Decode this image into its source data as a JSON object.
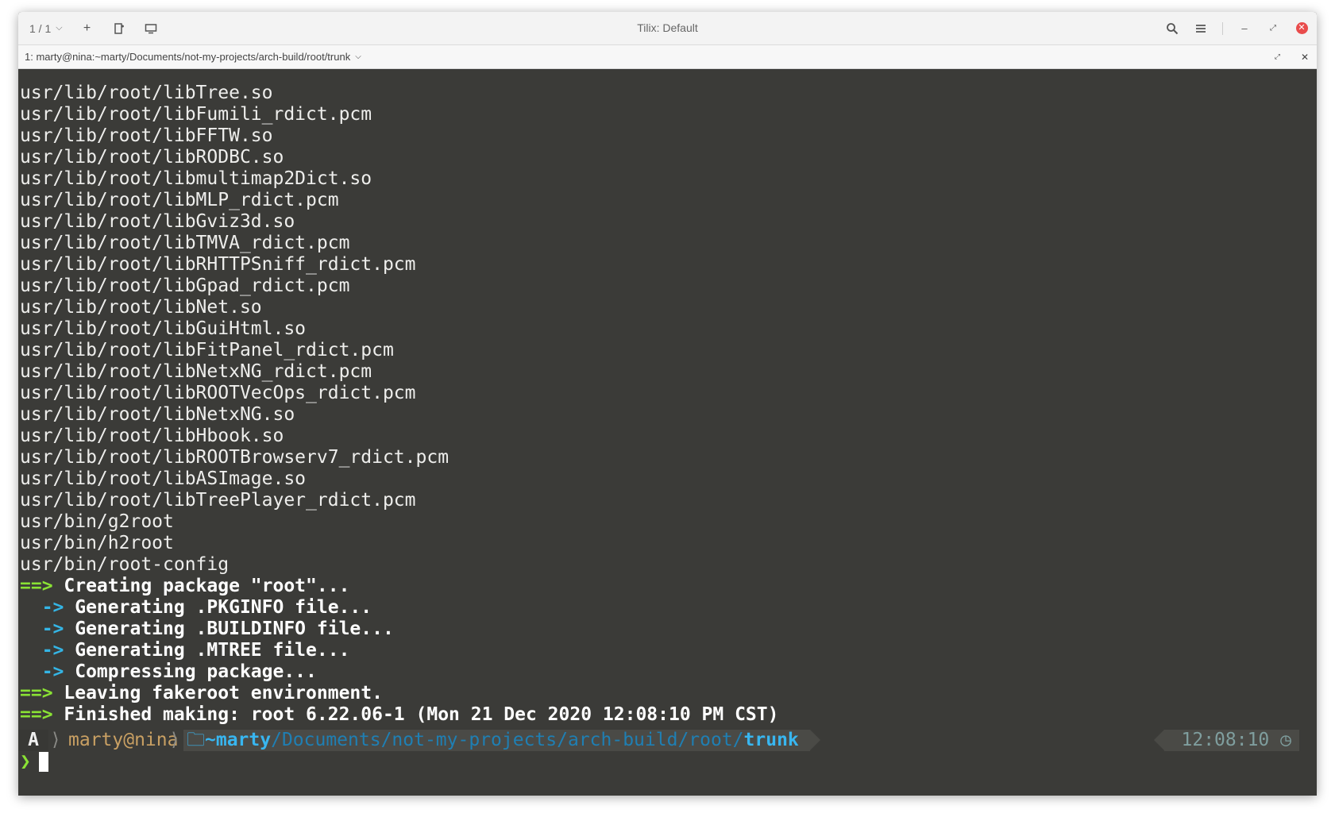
{
  "header": {
    "session_label": "1 / 1",
    "title": "Tilix: Default"
  },
  "tab": {
    "title": "1: marty@nina:~marty/Documents/not-my-projects/arch-build/root/trunk"
  },
  "output_lines": [
    "usr/lib/root/libTree.so",
    "usr/lib/root/libFumili_rdict.pcm",
    "usr/lib/root/libFFTW.so",
    "usr/lib/root/libRODBC.so",
    "usr/lib/root/libmultimap2Dict.so",
    "usr/lib/root/libMLP_rdict.pcm",
    "usr/lib/root/libGviz3d.so",
    "usr/lib/root/libTMVA_rdict.pcm",
    "usr/lib/root/libRHTTPSniff_rdict.pcm",
    "usr/lib/root/libGpad_rdict.pcm",
    "usr/lib/root/libNet.so",
    "usr/lib/root/libGuiHtml.so",
    "usr/lib/root/libFitPanel_rdict.pcm",
    "usr/lib/root/libNetxNG_rdict.pcm",
    "usr/lib/root/libROOTVecOps_rdict.pcm",
    "usr/lib/root/libNetxNG.so",
    "usr/lib/root/libHbook.so",
    "usr/lib/root/libROOTBrowserv7_rdict.pcm",
    "usr/lib/root/libASImage.so",
    "usr/lib/root/libTreePlayer_rdict.pcm",
    "usr/bin/g2root",
    "usr/bin/h2root",
    "usr/bin/root-config"
  ],
  "build_messages": {
    "main_marker": "==>",
    "sub_marker": "  ->",
    "creating": " Creating package \"root\"...",
    "pkginfo": " Generating .PKGINFO file...",
    "buildinfo": " Generating .BUILDINFO file...",
    "mtree": " Generating .MTREE file...",
    "compressing": " Compressing package...",
    "leaving": " Leaving fakeroot environment.",
    "finished": " Finished making: root 6.22.06-1 (Mon 21 Dec 2020 12:08:10 PM CST)"
  },
  "prompt": {
    "arch_glyph": "A",
    "user_host": "marty@nina",
    "home": "~marty",
    "path_middle": "/Documents/not-my-projects/arch-build/root/",
    "current_dir": "trunk",
    "time": "12:08:10",
    "prompt_char": "❯"
  }
}
